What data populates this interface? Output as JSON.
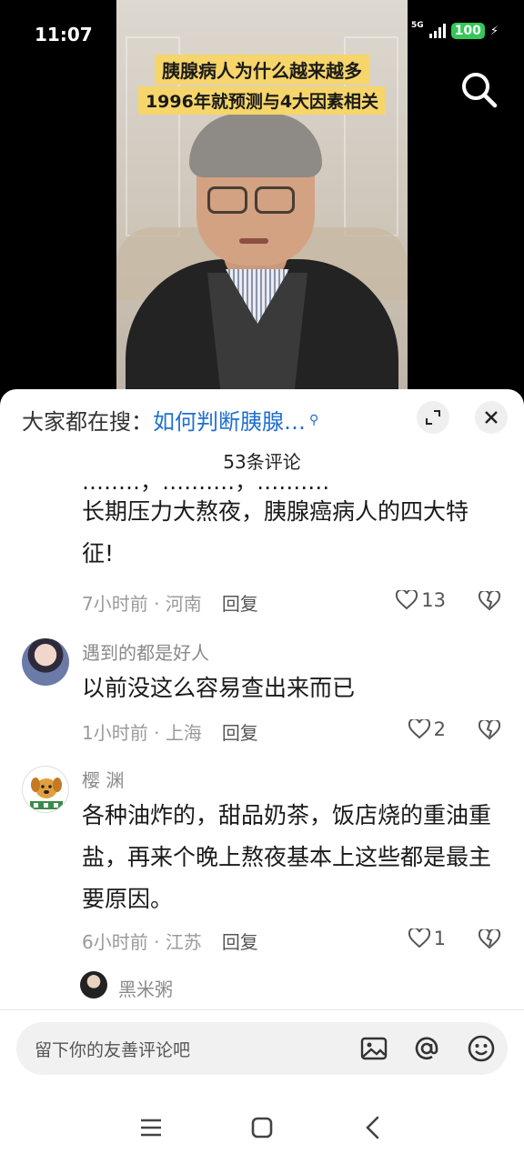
{
  "status_bar": {
    "time": "11:07",
    "network": "5G",
    "battery": "100"
  },
  "video": {
    "caption_line1": "胰腺病人为什么越来越多",
    "caption_line2": "1996年就预测与4大因素相关",
    "caption_bg_color": "#f6d56a"
  },
  "sheet": {
    "hot_search_prefix": "大家都在搜：",
    "hot_search_query": "如何判断胰腺…",
    "comment_count": "53条评论",
    "accent_color": "#1f6fd1"
  },
  "comments": [
    {
      "text": "长期压力大熬夜，胰腺癌病人的四大特征!",
      "time": "7小时前",
      "location": "河南",
      "reply_label": "回复",
      "likes": "13"
    },
    {
      "user": "遇到的都是好人",
      "text": "以前没这么容易查出来而已",
      "time": "1小时前",
      "location": "上海",
      "reply_label": "回复",
      "likes": "2"
    },
    {
      "user": "樱 渊",
      "text": "各种油炸的，甜品奶茶，饭店烧的重油重盐，再来个晚上熬夜基本上这些都是最主要原因。",
      "time": "6小时前",
      "location": "江苏",
      "reply_label": "回复",
      "likes": "1"
    }
  ],
  "sub_reply_user": "黑米粥",
  "input": {
    "placeholder": "留下你的友善评论吧"
  },
  "icons": {
    "search": "search-icon",
    "expand": "expand-icon",
    "close": "close-icon",
    "like": "heart-icon",
    "dislike": "broken-heart-icon",
    "image": "image-icon",
    "mention": "at-icon",
    "emoji": "emoji-icon",
    "nav_menu": "menu-icon",
    "nav_home": "home-icon",
    "nav_back": "back-icon"
  }
}
